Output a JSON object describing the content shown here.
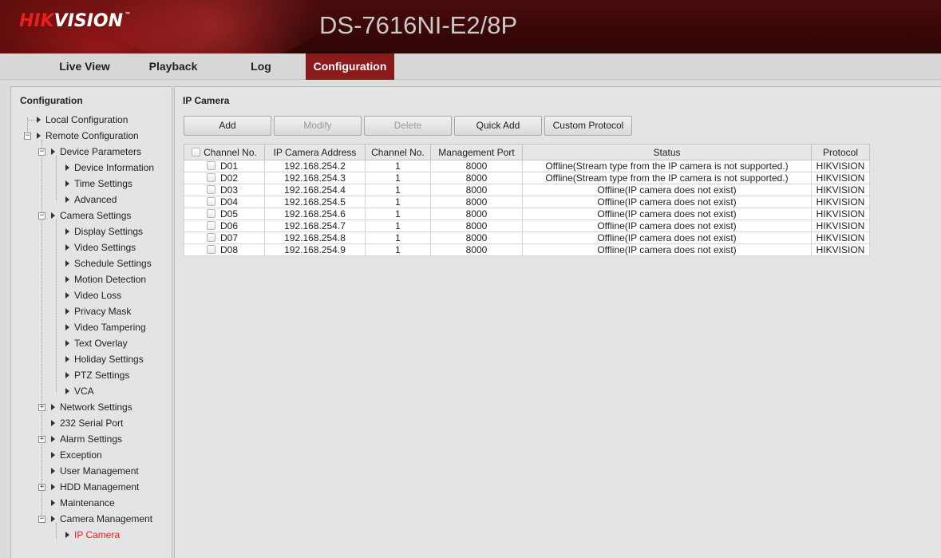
{
  "header": {
    "logo_text_red": "HIK",
    "logo_text_white": "VISION",
    "logo_mark": "™",
    "model": "DS-7616NI-E2/8P"
  },
  "nav": {
    "tabs": [
      {
        "label": "Live View"
      },
      {
        "label": "Playback"
      },
      {
        "label": "Log"
      },
      {
        "label": "Configuration",
        "active": true
      }
    ]
  },
  "sidebar": {
    "title": "Configuration",
    "items": [
      {
        "label": "Local Configuration"
      },
      {
        "label": "Remote Configuration"
      },
      {
        "label": "Device Parameters"
      },
      {
        "label": "Device Information"
      },
      {
        "label": "Time Settings"
      },
      {
        "label": "Advanced"
      },
      {
        "label": "Camera Settings"
      },
      {
        "label": "Display Settings"
      },
      {
        "label": "Video Settings"
      },
      {
        "label": "Schedule Settings"
      },
      {
        "label": "Motion Detection"
      },
      {
        "label": "Video Loss"
      },
      {
        "label": "Privacy Mask"
      },
      {
        "label": "Video Tampering"
      },
      {
        "label": "Text Overlay"
      },
      {
        "label": "Holiday Settings"
      },
      {
        "label": "PTZ Settings"
      },
      {
        "label": "VCA"
      },
      {
        "label": "Network Settings"
      },
      {
        "label": "232 Serial Port"
      },
      {
        "label": "Alarm Settings"
      },
      {
        "label": "Exception"
      },
      {
        "label": "User Management"
      },
      {
        "label": "HDD Management"
      },
      {
        "label": "Maintenance"
      },
      {
        "label": "Camera Management"
      },
      {
        "label": "IP Camera",
        "selected": true
      }
    ]
  },
  "main": {
    "title": "IP Camera",
    "buttons": {
      "add": "Add",
      "modify": "Modify",
      "delete": "Delete",
      "quick_add": "Quick Add",
      "custom_protocol": "Custom Protocol"
    },
    "table": {
      "headers": [
        "Channel No.",
        "IP Camera Address",
        "Channel No.",
        "Management Port",
        "Status",
        "Protocol"
      ],
      "rows": [
        {
          "channel": "D01",
          "ip": "192.168.254.2",
          "ch_no": "1",
          "port": "8000",
          "status": "Offline(Stream type from the IP camera is not supported.)",
          "protocol": "HIKVISION"
        },
        {
          "channel": "D02",
          "ip": "192.168.254.3",
          "ch_no": "1",
          "port": "8000",
          "status": "Offline(Stream type from the IP camera is not supported.)",
          "protocol": "HIKVISION"
        },
        {
          "channel": "D03",
          "ip": "192.168.254.4",
          "ch_no": "1",
          "port": "8000",
          "status": "Offline(IP camera does not exist)",
          "protocol": "HIKVISION"
        },
        {
          "channel": "D04",
          "ip": "192.168.254.5",
          "ch_no": "1",
          "port": "8000",
          "status": "Offline(IP camera does not exist)",
          "protocol": "HIKVISION"
        },
        {
          "channel": "D05",
          "ip": "192.168.254.6",
          "ch_no": "1",
          "port": "8000",
          "status": "Offline(IP camera does not exist)",
          "protocol": "HIKVISION"
        },
        {
          "channel": "D06",
          "ip": "192.168.254.7",
          "ch_no": "1",
          "port": "8000",
          "status": "Offline(IP camera does not exist)",
          "protocol": "HIKVISION"
        },
        {
          "channel": "D07",
          "ip": "192.168.254.8",
          "ch_no": "1",
          "port": "8000",
          "status": "Offline(IP camera does not exist)",
          "protocol": "HIKVISION"
        },
        {
          "channel": "D08",
          "ip": "192.168.254.9",
          "ch_no": "1",
          "port": "8000",
          "status": "Offline(IP camera does not exist)",
          "protocol": "HIKVISION"
        }
      ]
    }
  },
  "colors": {
    "brand_red": "#e3211b",
    "active_tab": "#8b1a1a",
    "header_dark": "#3a0707"
  }
}
